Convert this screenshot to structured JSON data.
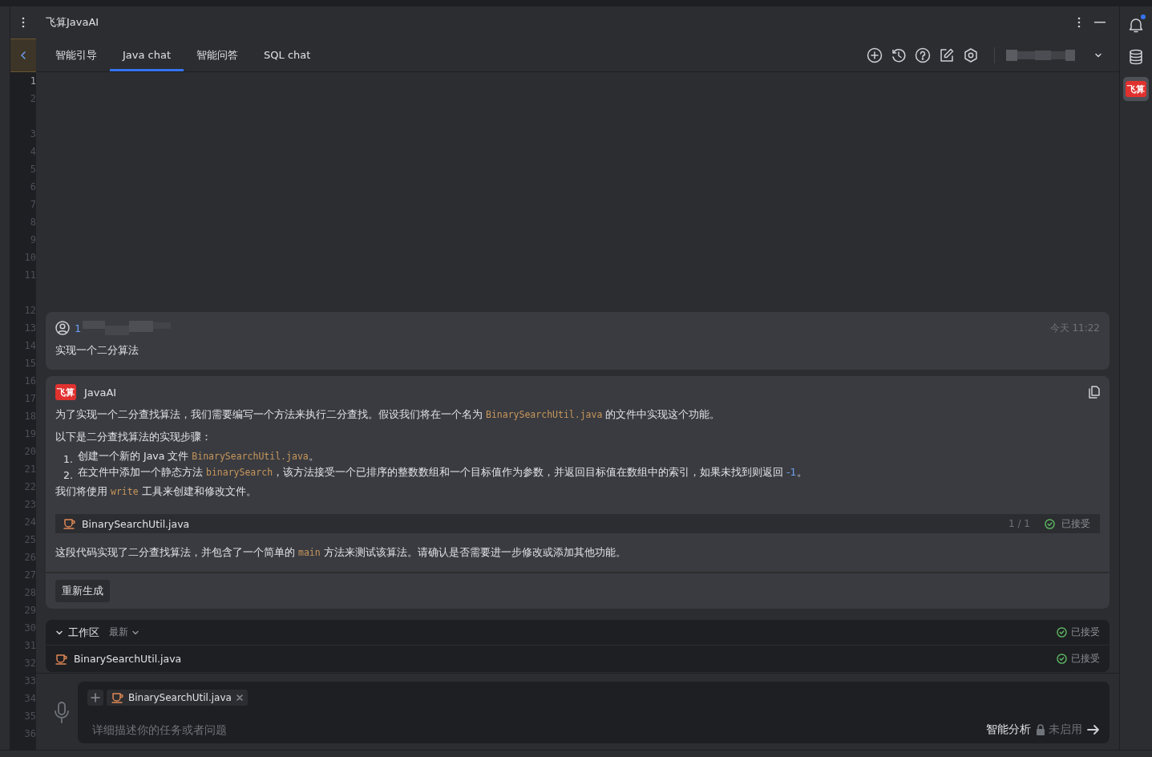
{
  "window": {
    "title": "飞算JavaAI"
  },
  "gutter": [
    {
      "kind": "number",
      "label": "1",
      "current": true
    },
    {
      "kind": "number",
      "label": "2",
      "current": false
    },
    {
      "kind": "blank"
    },
    {
      "kind": "number",
      "label": "3",
      "current": false
    },
    {
      "kind": "number",
      "label": "4",
      "current": false
    },
    {
      "kind": "number",
      "label": "5",
      "current": false
    },
    {
      "kind": "number",
      "label": "6",
      "current": false
    },
    {
      "kind": "number",
      "label": "7",
      "current": false
    },
    {
      "kind": "number",
      "label": "8",
      "current": false
    },
    {
      "kind": "number",
      "label": "9",
      "current": false
    },
    {
      "kind": "number",
      "label": "10",
      "current": false
    },
    {
      "kind": "number",
      "label": "11",
      "current": false
    },
    {
      "kind": "blank"
    },
    {
      "kind": "number",
      "label": "12",
      "current": false
    },
    {
      "kind": "number",
      "label": "13",
      "current": false
    },
    {
      "kind": "number",
      "label": "14",
      "current": false
    },
    {
      "kind": "number",
      "label": "15",
      "current": false
    },
    {
      "kind": "number",
      "label": "16",
      "current": false
    },
    {
      "kind": "number",
      "label": "17",
      "current": false
    },
    {
      "kind": "number",
      "label": "18",
      "current": false
    },
    {
      "kind": "number",
      "label": "19",
      "current": false
    },
    {
      "kind": "number",
      "label": "20",
      "current": false
    },
    {
      "kind": "number",
      "label": "21",
      "current": false
    },
    {
      "kind": "number",
      "label": "22",
      "current": false
    },
    {
      "kind": "number",
      "label": "23",
      "current": false
    },
    {
      "kind": "number",
      "label": "24",
      "current": false
    },
    {
      "kind": "number",
      "label": "25",
      "current": false
    },
    {
      "kind": "number",
      "label": "26",
      "current": false
    },
    {
      "kind": "number",
      "label": "27",
      "current": false
    },
    {
      "kind": "number",
      "label": "28",
      "current": false
    },
    {
      "kind": "number",
      "label": "29",
      "current": false
    },
    {
      "kind": "number",
      "label": "30",
      "current": false
    },
    {
      "kind": "number",
      "label": "31",
      "current": false
    },
    {
      "kind": "number",
      "label": "32",
      "current": false
    },
    {
      "kind": "number",
      "label": "33",
      "current": false
    },
    {
      "kind": "number",
      "label": "34",
      "current": false
    },
    {
      "kind": "number",
      "label": "35",
      "current": false
    },
    {
      "kind": "number",
      "label": "36",
      "current": false
    }
  ],
  "tabs": [
    {
      "label": "智能引导",
      "selected": false
    },
    {
      "label": "Java chat",
      "selected": true
    },
    {
      "label": "智能问答",
      "selected": false
    },
    {
      "label": "SQL chat",
      "selected": false
    }
  ],
  "user_message": {
    "name": "1",
    "time": "今天 11:22",
    "text": "实现一个二分算法"
  },
  "ai_message": {
    "logo": "飞算",
    "name": "JavaAI",
    "paragraphs": [
      [
        {
          "kind": "text",
          "text": "为了实现一个二分查找算法，我们需要编写一个方法来执行二分查找。假设我们将在一个名为 "
        },
        {
          "kind": "code",
          "text": "BinarySearchUtil.java"
        },
        {
          "kind": "text",
          "text": " 的文件中实现这个功能。"
        }
      ],
      [
        {
          "kind": "text",
          "text": "以下是二分查找算法的实现步骤："
        }
      ]
    ],
    "steps": [
      {
        "marker": "1.",
        "parts": [
          {
            "kind": "text",
            "text": "创建一个新的 Java 文件 "
          },
          {
            "kind": "code",
            "text": "BinarySearchUtil.java"
          },
          {
            "kind": "text",
            "text": "。"
          }
        ]
      },
      {
        "marker": "2.",
        "parts": [
          {
            "kind": "text",
            "text": "在文件中添加一个静态方法 "
          },
          {
            "kind": "code",
            "text": "binarySearch"
          },
          {
            "kind": "text",
            "text": "，该方法接受一个已排序的整数数组和一个目标值作为参数，并返回目标值在数组中的索引，如果未找到则返回 "
          },
          {
            "kind": "number",
            "text": "-1"
          },
          {
            "kind": "text",
            "text": "。"
          }
        ]
      }
    ],
    "after_steps": [
      {
        "kind": "text",
        "text": "我们将使用 "
      },
      {
        "kind": "code",
        "text": "write"
      },
      {
        "kind": "text",
        "text": " 工具来创建和修改文件。"
      }
    ],
    "file": {
      "name": "BinarySearchUtil.java",
      "count": "1 / 1",
      "status": "已接受"
    },
    "closing": [
      {
        "kind": "text",
        "text": "这段代码实现了二分查找算法，并包含了一个简单的 "
      },
      {
        "kind": "code",
        "text": "main"
      },
      {
        "kind": "text",
        "text": " 方法来测试该算法。请确认是否需要进一步修改或添加其他功能。"
      }
    ],
    "regenerate": "重新生成"
  },
  "workspace": {
    "title": "工作区",
    "filter": "最新",
    "expanded": true,
    "status": "已接受",
    "files": [
      {
        "name": "BinarySearchUtil.java",
        "status": "已接受"
      }
    ]
  },
  "input": {
    "chip": "BinarySearchUtil.java",
    "placeholder": "详细描述你的任务或者问题",
    "mode": "智能分析",
    "mode_state": "未启用"
  },
  "right_bar": {
    "logo": "飞算",
    "notification": true
  }
}
